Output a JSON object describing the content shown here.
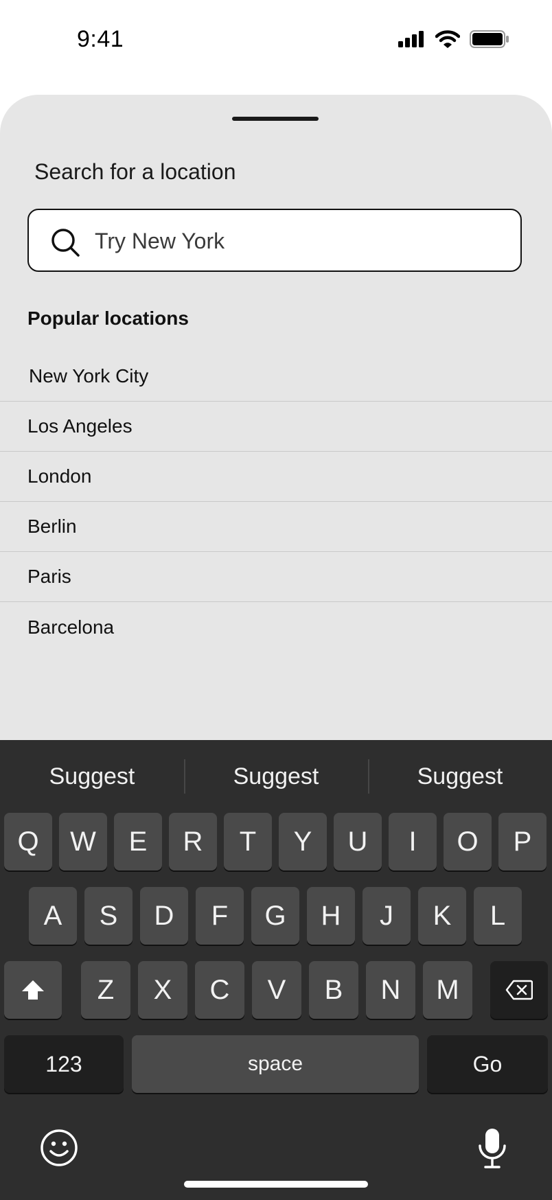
{
  "status_bar": {
    "time": "9:41"
  },
  "sheet": {
    "title": "Search for a location",
    "search": {
      "placeholder": "Try New York",
      "value": ""
    },
    "section_label": "Popular locations",
    "locations": [
      "New York City",
      "Los Angeles",
      "London",
      "Berlin",
      "Paris",
      "Barcelona"
    ]
  },
  "keyboard": {
    "suggestions": [
      "Suggest",
      "Suggest",
      "Suggest"
    ],
    "row1": [
      "Q",
      "W",
      "E",
      "R",
      "T",
      "Y",
      "U",
      "I",
      "O",
      "P"
    ],
    "row2": [
      "A",
      "S",
      "D",
      "F",
      "G",
      "H",
      "J",
      "K",
      "L"
    ],
    "row3": [
      "Z",
      "X",
      "C",
      "V",
      "B",
      "N",
      "M"
    ],
    "numbers_label": "123",
    "space_label": "space",
    "go_label": "Go"
  },
  "colors": {
    "sheet_background": "#e6e6e6",
    "keyboard_background": "#2e2e2e",
    "key_background": "#4a4a4a",
    "function_key_background": "#1f1f1f"
  },
  "icons": [
    "signal-icon",
    "wifi-icon",
    "battery-icon",
    "search-icon",
    "shift-icon",
    "backspace-icon",
    "emoji-icon",
    "microphone-icon"
  ]
}
